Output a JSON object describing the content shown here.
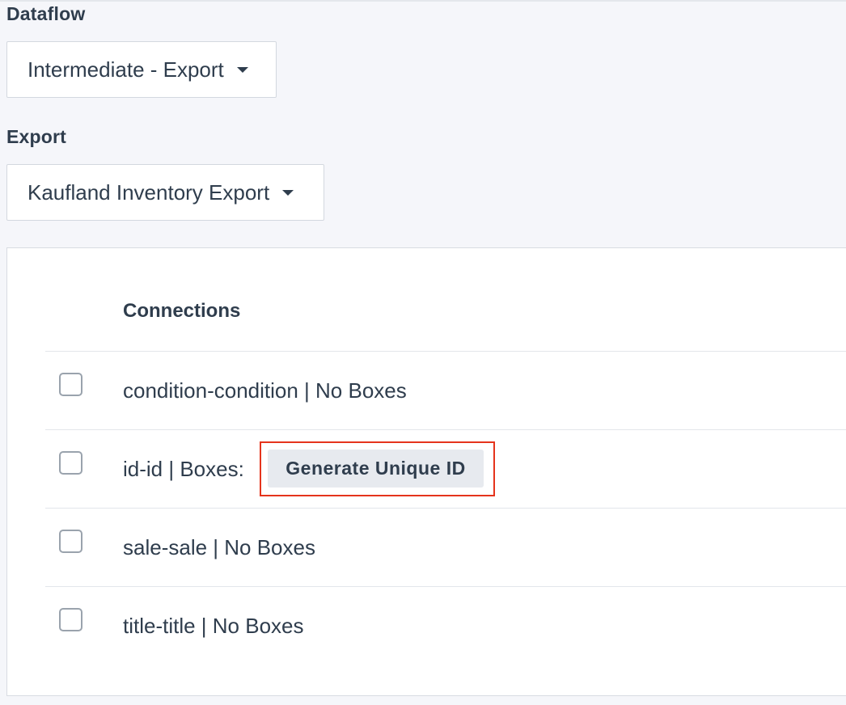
{
  "dataflow": {
    "label": "Dataflow",
    "selected": "Intermediate - Export"
  },
  "export": {
    "label": "Export",
    "selected": "Kaufland Inventory Export"
  },
  "connections": {
    "heading": "Connections",
    "rows": [
      {
        "text": "condition-condition | No Boxes",
        "checked": false
      },
      {
        "text": "id-id | Boxes:",
        "checked": false,
        "box": "Generate Unique ID"
      },
      {
        "text": "sale-sale | No Boxes",
        "checked": false
      },
      {
        "text": "title-title | No Boxes",
        "checked": false
      }
    ]
  },
  "colors": {
    "background": "#f5f6fa",
    "text": "#2f3d4d",
    "highlight": "#e5341c",
    "chip": "#e7eaef"
  }
}
